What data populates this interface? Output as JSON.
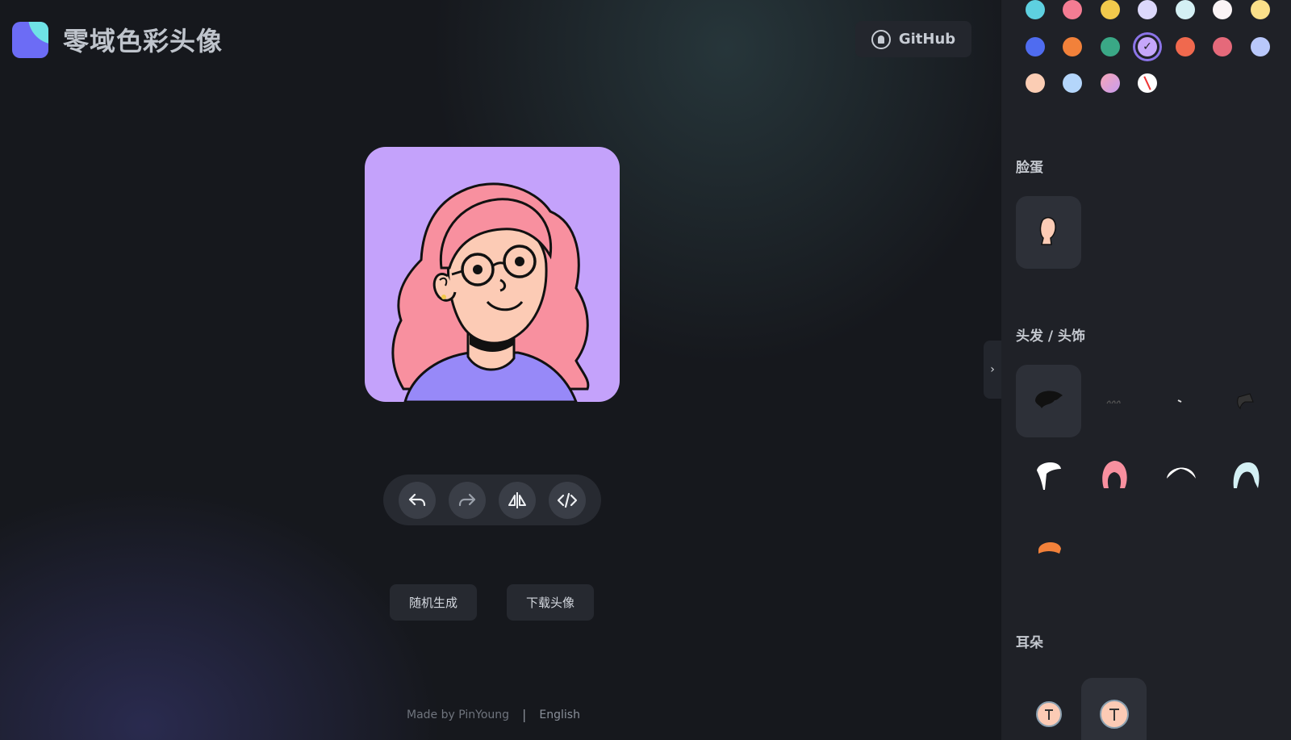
{
  "header": {
    "app_title": "零域色彩头像",
    "github_label": "GitHub"
  },
  "toolbar": {
    "undo": "undo-icon",
    "redo": "redo-icon",
    "flip": "flip-icon",
    "code": "code-icon"
  },
  "actions": {
    "random_label": "随机生成",
    "download_label": "下载头像"
  },
  "footer": {
    "credit": "Made by PinYoung",
    "separator": "|",
    "language": "English"
  },
  "sidebar": {
    "background_colors": [
      "#5ed0e0",
      "#f47c93",
      "#f2c94c",
      "#dcd8fb",
      "#d4f0f4",
      "#fbf4f6",
      "#fbe08a",
      "#4f6cf0",
      "#f2813a",
      "#3aa886",
      "#c5a6fa",
      "#f0694e",
      "#e5697a",
      "#b9c8fb",
      "#fbcdb4",
      "#b4d6fb",
      "#e89ac2",
      "none"
    ],
    "selected_color": "#c5a6fa",
    "sections": {
      "face": "脸蛋",
      "hair": "头发 / 头饰",
      "ears": "耳朵"
    }
  },
  "colors": {
    "accent": "#8c74e8",
    "avatar_bg": "#c4a2fb",
    "hair": "#f8909f",
    "skin": "#fccbb5",
    "shirt": "#9789f8"
  }
}
